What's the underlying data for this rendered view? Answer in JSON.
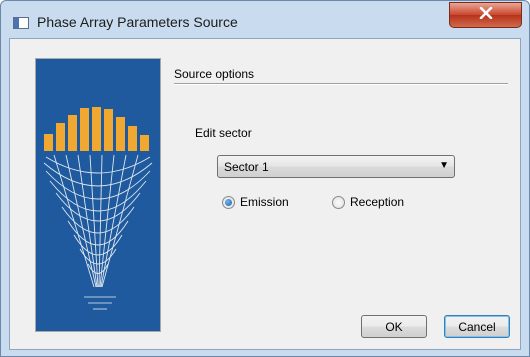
{
  "window": {
    "title": "Phase Array Parameters Source",
    "icon": "window-app-icon",
    "close_icon": "close-icon"
  },
  "source_options": {
    "label": "Source options"
  },
  "edit_sector": {
    "label": "Edit sector",
    "selected": "Sector 1",
    "dropdown_icon": "chevron-down-icon"
  },
  "mode": {
    "emission_label": "Emission",
    "reception_label": "Reception",
    "selected": "Emission"
  },
  "buttons": {
    "ok_label": "OK",
    "cancel_label": "Cancel"
  },
  "colors": {
    "banner_blue": "#1f5a9e",
    "element_orange": "#f0a830",
    "close_red": "#c8472d"
  }
}
